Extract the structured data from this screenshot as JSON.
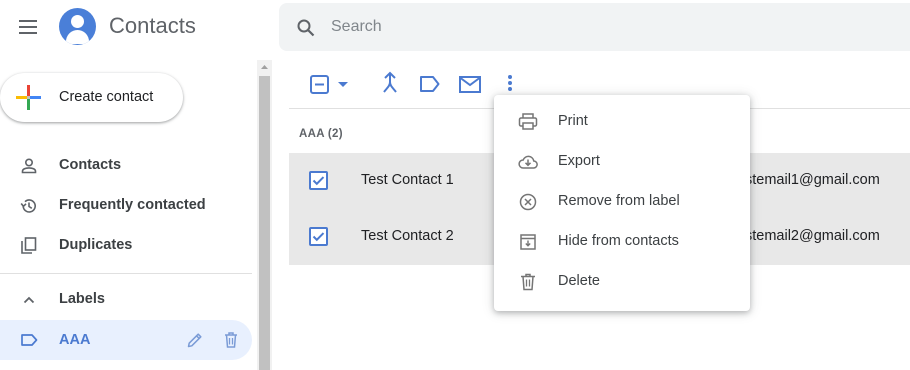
{
  "app": {
    "title": "Contacts",
    "create_label": "Create contact"
  },
  "search": {
    "placeholder": "Search",
    "value": ""
  },
  "sidebar": {
    "items": [
      {
        "label": "Contacts",
        "icon": "person-icon"
      },
      {
        "label": "Frequently contacted",
        "icon": "history-icon"
      },
      {
        "label": "Duplicates",
        "icon": "copy-icon"
      }
    ],
    "labels_header": "Labels",
    "label_items": [
      {
        "label": "AAA",
        "icon": "label-icon",
        "selected": true
      }
    ]
  },
  "toolbar": {
    "icons": [
      "select-all-icon",
      "dropdown-arrow-icon",
      "merge-icon",
      "label-icon",
      "email-icon",
      "more-vert-icon"
    ]
  },
  "group": {
    "label": "AAA (2)"
  },
  "contacts": [
    {
      "name": "Test Contact 1",
      "email": "stemail1@gmail.com",
      "checked": true
    },
    {
      "name": "Test Contact 2",
      "email": "stemail2@gmail.com",
      "checked": true
    }
  ],
  "menu": {
    "items": [
      {
        "label": "Print",
        "icon": "print-icon"
      },
      {
        "label": "Export",
        "icon": "cloud-download-icon"
      },
      {
        "label": "Remove from label",
        "icon": "remove-circle-icon"
      },
      {
        "label": "Hide from contacts",
        "icon": "archive-icon"
      },
      {
        "label": "Delete",
        "icon": "trash-icon"
      }
    ]
  },
  "colors": {
    "accent": "#4b7ad0",
    "selected_nav_bg": "#e8f0fe",
    "selected_row_bg": "#e8e8e8",
    "search_bg": "#f1f3f4"
  }
}
